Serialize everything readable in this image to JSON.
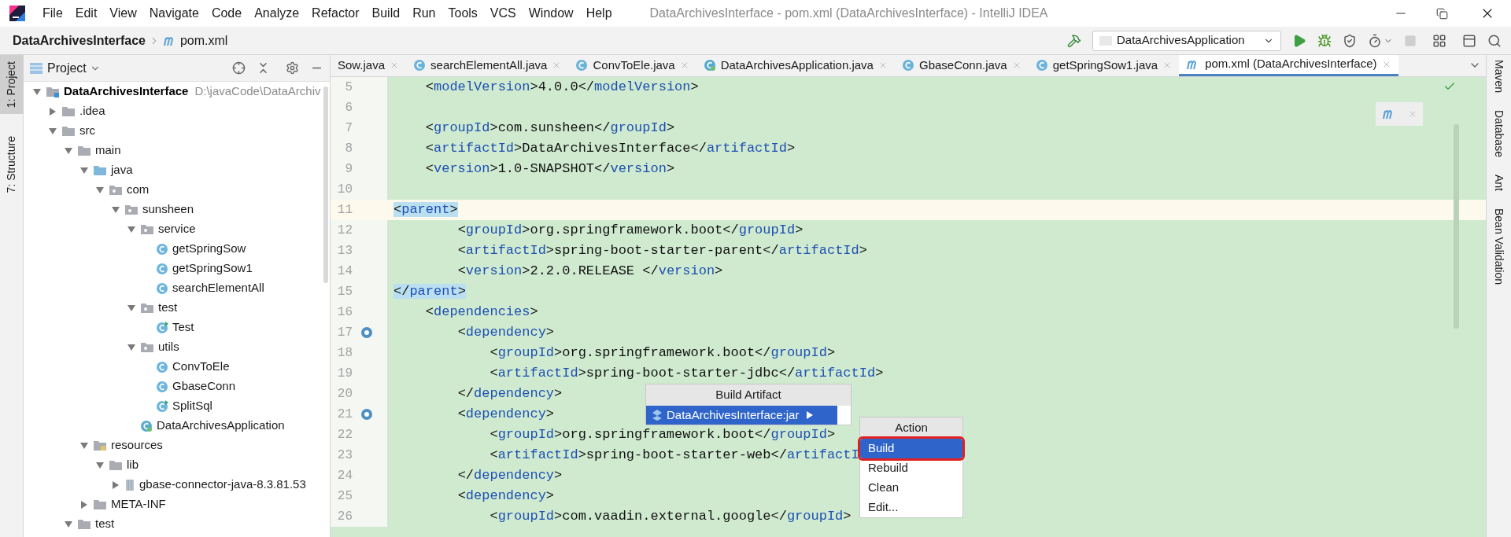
{
  "window": {
    "title": "DataArchivesInterface - pom.xml (DataArchivesInterface) - IntelliJ IDEA"
  },
  "menu": [
    "File",
    "Edit",
    "View",
    "Navigate",
    "Code",
    "Analyze",
    "Refactor",
    "Build",
    "Run",
    "Tools",
    "VCS",
    "Window",
    "Help"
  ],
  "breadcrumb": {
    "project": "DataArchivesInterface",
    "file": "pom.xml"
  },
  "run_config": "DataArchivesApplication",
  "left_strip": [
    {
      "label": "1: Project",
      "selected": true
    },
    {
      "label": "7: Structure",
      "selected": false
    }
  ],
  "right_strip": [
    "Maven",
    "Database",
    "Ant",
    "Bean Validation"
  ],
  "project_panel": {
    "title": "Project",
    "tree": [
      {
        "kind": "module",
        "name": "DataArchivesInterface",
        "path": "D:\\javaCode\\DataArchiv",
        "expanded": true,
        "children": [
          {
            "kind": "folder",
            "name": ".idea",
            "expanded": false
          },
          {
            "kind": "folder",
            "name": "src",
            "expanded": true,
            "children": [
              {
                "kind": "folder",
                "name": "main",
                "expanded": true,
                "children": [
                  {
                    "kind": "source-folder",
                    "name": "java",
                    "expanded": true,
                    "children": [
                      {
                        "kind": "package",
                        "name": "com",
                        "expanded": true,
                        "children": [
                          {
                            "kind": "package",
                            "name": "sunsheen",
                            "expanded": true,
                            "children": [
                              {
                                "kind": "package",
                                "name": "service",
                                "expanded": true,
                                "children": [
                                  {
                                    "kind": "class",
                                    "name": "getSpringSow"
                                  },
                                  {
                                    "kind": "class",
                                    "name": "getSpringSow1"
                                  },
                                  {
                                    "kind": "class",
                                    "name": "searchElementAll"
                                  }
                                ]
                              },
                              {
                                "kind": "package",
                                "name": "test",
                                "expanded": true,
                                "children": [
                                  {
                                    "kind": "runnable-class",
                                    "name": "Test"
                                  }
                                ]
                              },
                              {
                                "kind": "package",
                                "name": "utils",
                                "expanded": true,
                                "children": [
                                  {
                                    "kind": "class",
                                    "name": "ConvToEle"
                                  },
                                  {
                                    "kind": "class",
                                    "name": "GbaseConn"
                                  },
                                  {
                                    "kind": "runnable-class",
                                    "name": "SplitSql"
                                  }
                                ]
                              },
                              {
                                "kind": "app-class",
                                "name": "DataArchivesApplication"
                              }
                            ]
                          }
                        ]
                      }
                    ]
                  },
                  {
                    "kind": "resources-folder",
                    "name": "resources",
                    "expanded": true,
                    "children": [
                      {
                        "kind": "folder",
                        "name": "lib",
                        "expanded": true,
                        "children": [
                          {
                            "kind": "jar",
                            "name": "gbase-connector-java-8.3.81.53",
                            "expanded": false
                          }
                        ]
                      }
                    ]
                  },
                  {
                    "kind": "folder",
                    "name": "META-INF",
                    "expanded": false
                  }
                ]
              },
              {
                "kind": "folder",
                "name": "test",
                "expanded": true
              }
            ]
          }
        ]
      }
    ]
  },
  "tabs": [
    {
      "label": "Sow.java",
      "selected": false
    },
    {
      "label": "searchElementAll.java",
      "kind": "class",
      "selected": false
    },
    {
      "label": "ConvToEle.java",
      "kind": "class",
      "selected": false
    },
    {
      "label": "DataArchivesApplication.java",
      "kind": "app-class",
      "selected": false
    },
    {
      "label": "GbaseConn.java",
      "kind": "class",
      "selected": false
    },
    {
      "label": "getSpringSow1.java",
      "kind": "class",
      "selected": false
    },
    {
      "label": "pom.xml (DataArchivesInterface)",
      "kind": "maven",
      "selected": true
    }
  ],
  "editor": {
    "lines": [
      {
        "number": "5",
        "text": "    <modelVersion>4.0.0</modelVersion>"
      },
      {
        "number": "6"
      },
      {
        "number": "7",
        "text": "    <groupId>com.sunsheen</groupId>"
      },
      {
        "number": "8",
        "text": "    <artifactId>DataArchivesInterface</artifactId>"
      },
      {
        "number": "9",
        "text": "    <version>1.0-SNAPSHOT</version>"
      },
      {
        "number": "10"
      },
      {
        "number": "11",
        "text": "    <parent>",
        "current": true,
        "matched": true
      },
      {
        "number": "12",
        "text": "        <groupId>org.springframework.boot</groupId>"
      },
      {
        "number": "13",
        "text": "        <artifactId>spring-boot-starter-parent</artifactId>"
      },
      {
        "number": "14",
        "text": "        <version>2.2.0.RELEASE </version>"
      },
      {
        "number": "15",
        "text": "    </parent>",
        "matched": true
      },
      {
        "number": "16",
        "text": "    <dependencies>"
      },
      {
        "number": "17",
        "text": "        <dependency>",
        "gutter_icon": true
      },
      {
        "number": "18",
        "text": "            <groupId>org.springframework.boot</groupId>"
      },
      {
        "number": "19",
        "text": "            <artifactId>spring-boot-starter-jdbc</artifactId>"
      },
      {
        "number": "20",
        "text": "        </dependency>"
      },
      {
        "number": "21",
        "text": "        <dependency>",
        "gutter_icon": true
      },
      {
        "number": "22",
        "text": "            <groupId>org.springframework.boot</groupId>"
      },
      {
        "number": "23",
        "text": "            <artifactId>spring-boot-starter-web</artifactI"
      },
      {
        "number": "24",
        "text": "        </dependency>"
      },
      {
        "number": "25",
        "text": "        <dependency>"
      },
      {
        "number": "26",
        "text": "            <groupId>com.vaadin.external.google</groupId>"
      }
    ]
  },
  "build_popup": {
    "title": "Build Artifact",
    "items": [
      {
        "label": "DataArchivesInterface:jar",
        "selected": true
      }
    ]
  },
  "action_popup": {
    "title": "Action",
    "items": [
      {
        "label": "Build",
        "selected": true,
        "highlighted": true
      },
      {
        "label": "Rebuild",
        "selected": false,
        "highlighted": false
      },
      {
        "label": "Clean",
        "selected": false,
        "highlighted": false
      },
      {
        "label": "Edit...",
        "selected": false,
        "highlighted": false
      }
    ]
  }
}
